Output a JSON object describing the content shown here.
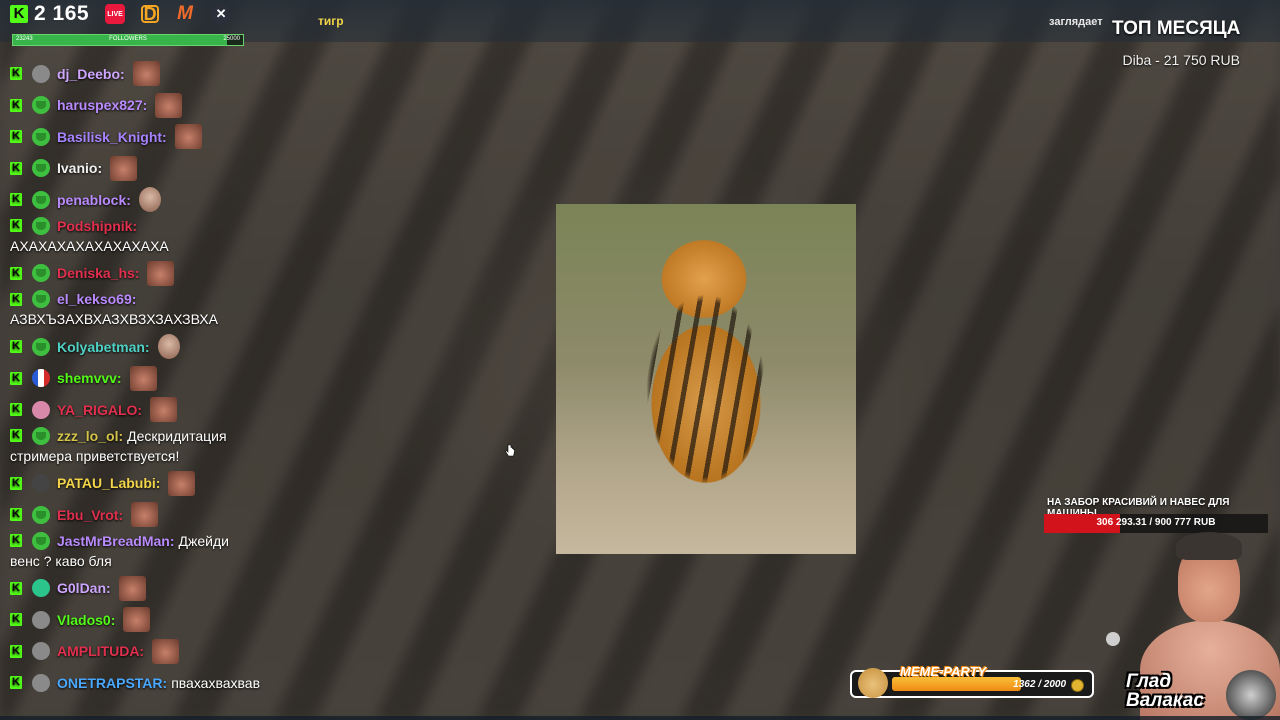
{
  "header": {
    "viewer_count": "2 165",
    "platforms": [
      {
        "name": "live-badge-icon",
        "label": "LIVE"
      },
      {
        "name": "dlive-icon",
        "label": "D"
      },
      {
        "name": "m-logo-icon",
        "label": "M"
      },
      {
        "name": "x-logo-icon",
        "label": "✕"
      }
    ],
    "followers": {
      "current": "23243",
      "label": "FOLLOWERS",
      "goal": "25000",
      "progress": 0.93
    },
    "topic": "тигр",
    "watching_label": "заглядает",
    "top_month_title": "ТОП МЕСЯЦА",
    "top_donor": "Diba - 21 750 RUB"
  },
  "chat": {
    "messages": [
      {
        "nick": "dj_Deebo:",
        "color": "#cfa6ff",
        "avatar": "gray",
        "text": "",
        "emote": "face"
      },
      {
        "nick": "haruspex827:",
        "color": "#b98bff",
        "avatar": "green",
        "text": "",
        "emote": "face"
      },
      {
        "nick": "Basilisk_Knight:",
        "color": "#a784ff",
        "avatar": "green",
        "text": "",
        "emote": "face"
      },
      {
        "nick": "Ivanio:",
        "color": "#f2f2f2",
        "avatar": "green",
        "text": "",
        "emote": "face"
      },
      {
        "nick": "penablock:",
        "color": "#b98bff",
        "avatar": "green",
        "text": "",
        "emote": "hand"
      },
      {
        "nick": "Podshipnik:",
        "color": "#e0304e",
        "avatar": "green",
        "text": "",
        "emote": "",
        "line2": "АХАХАХАХАХАХАХАХА"
      },
      {
        "nick": "Deniska_hs:",
        "color": "#e0304e",
        "avatar": "green",
        "text": "",
        "emote": "face"
      },
      {
        "nick": "el_kekso69:",
        "color": "#b98bff",
        "avatar": "green",
        "text": "",
        "emote": "",
        "line2": "АЗВХЪЗАХВХАЗХВЗХЗАХЗВХА"
      },
      {
        "nick": "Kolyabetman:",
        "color": "#4fd1c5",
        "avatar": "green",
        "text": "",
        "emote": "hand"
      },
      {
        "nick": "shemvvv:",
        "color": "#53fc18",
        "avatar": "flag",
        "text": "",
        "emote": "face"
      },
      {
        "nick": "YA_RIGALO:",
        "color": "#e0304e",
        "avatar": "pink",
        "text": "",
        "emote": "face"
      },
      {
        "nick": "zzz_lo_ol:",
        "color": "#d4c44a",
        "avatar": "green",
        "text": "Дескридитация",
        "emote": "",
        "line2": "стримера приветствуется!"
      },
      {
        "nick": "PATAU_Labubi:",
        "color": "#f2d54a",
        "avatar": "dark",
        "text": "",
        "emote": "face"
      },
      {
        "nick": "Ebu_Vrot:",
        "color": "#e0304e",
        "avatar": "green",
        "text": "",
        "emote": "face"
      },
      {
        "nick": "JastMrBreadMan:",
        "color": "#b98bff",
        "avatar": "green",
        "text": "Джейди",
        "emote": "",
        "line2": "венс ? каво бля"
      },
      {
        "nick": "G0lDan:",
        "color": "#cfa6ff",
        "avatar": "teal",
        "text": "",
        "emote": "face"
      },
      {
        "nick": "Vlados0:",
        "color": "#53fc18",
        "avatar": "gray",
        "text": "",
        "emote": "face"
      },
      {
        "nick": "AMPLITUDA:",
        "color": "#e0304e",
        "avatar": "gray",
        "text": "",
        "emote": "face"
      },
      {
        "nick": "ONETRAPSTAR:",
        "color": "#4aa8ff",
        "avatar": "gray",
        "text": "пвахахвахвав",
        "emote": ""
      }
    ]
  },
  "goal": {
    "title": "НА ЗАБОР КРАСИВИЙ И НАВЕС ДЛЯ МАШИНЫ",
    "amount": "306 293.31 / 900 777 RUB",
    "progress": 0.34
  },
  "meme_party": {
    "label": "MEME-PARTY",
    "count": "1362 / 2000",
    "progress": 0.68
  },
  "streamer": {
    "name_line1": "Глад",
    "name_line2": "Валакас"
  },
  "colors": {
    "kick_green": "#53fc18",
    "goal_red": "#d3131b",
    "meme_orange": "#f08a12"
  }
}
